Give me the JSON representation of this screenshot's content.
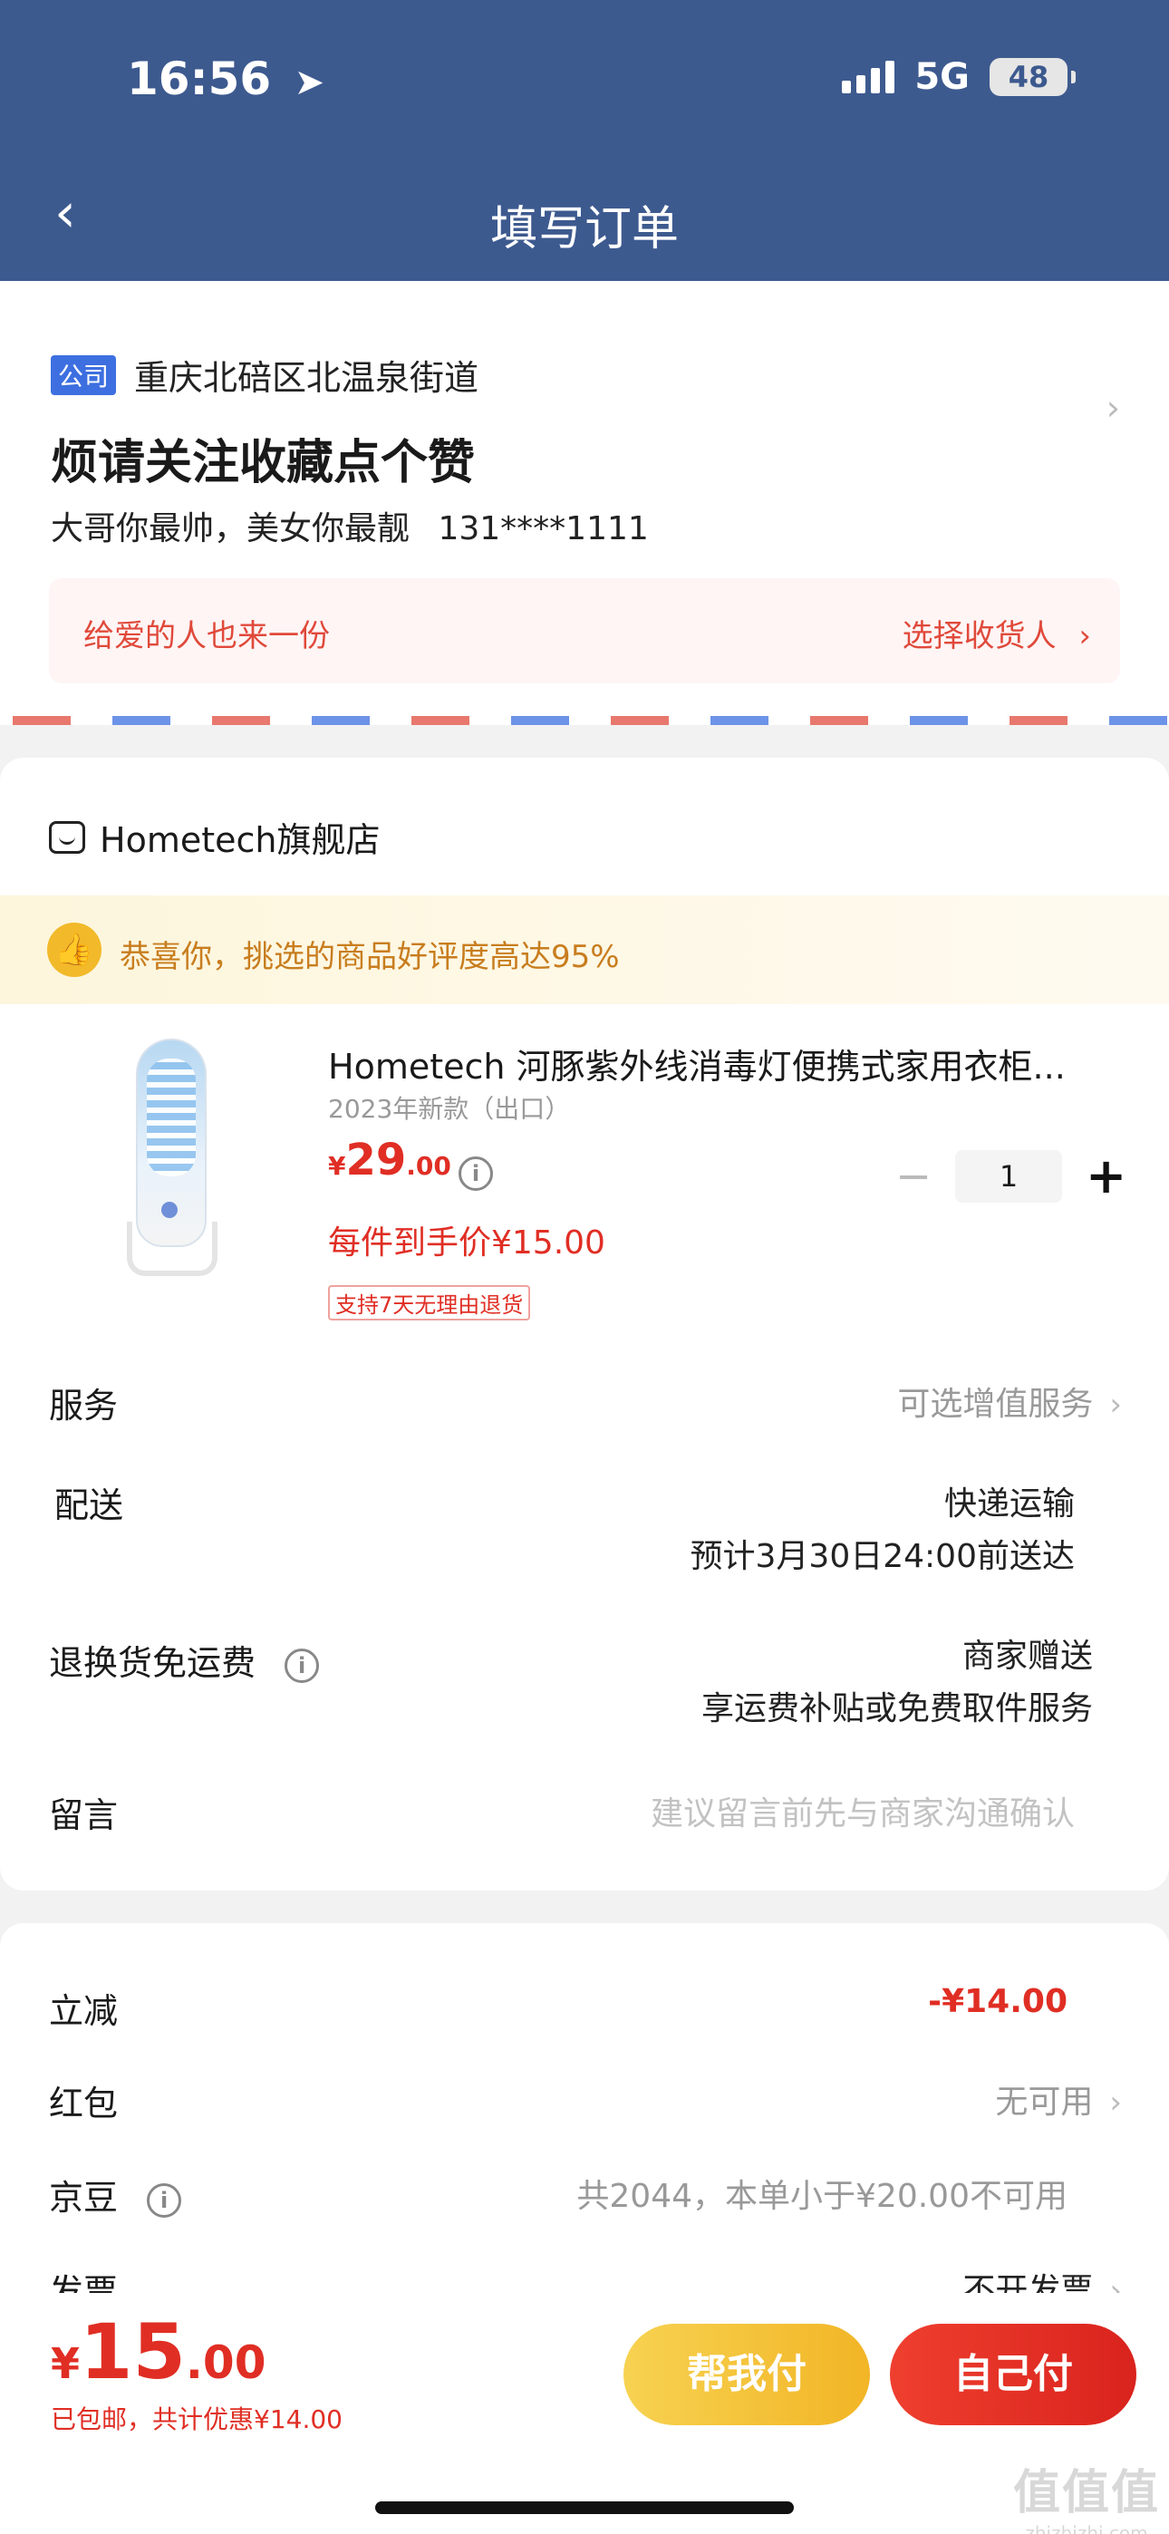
{
  "status_bar": {
    "time": "16:56",
    "network": "5G",
    "battery": "48"
  },
  "header": {
    "back_icon": "chevron-left-icon",
    "title": "填写订单"
  },
  "address": {
    "tag": "公司",
    "region": "重庆北碚区北温泉街道",
    "title": "烦请关注收藏点个赞",
    "name": "大哥你最帅，美女你最靓",
    "phone": "131****1111",
    "gift_left": "给爱的人也来一份",
    "gift_right": "选择收货人"
  },
  "store": {
    "name": "Hometech旗舰店",
    "praise": "恭喜你，挑选的商品好评度高达95%",
    "product": {
      "name": "Hometech 河豚紫外线消毒灯便携式家用衣柜...",
      "variant": "2023年新款（出口）",
      "price_symbol": "¥",
      "price_int": "29",
      "price_dec": ".00",
      "unit_price": "每件到手价¥15.00",
      "return_badge": "支持7天无理由退货",
      "quantity": "1",
      "minus": "−",
      "plus": "+"
    },
    "rows": {
      "service_label": "服务",
      "service_value": "可选增值服务",
      "delivery_label": "配送",
      "delivery_value": "快递运输",
      "delivery_eta": "预计3月30日24:00前送达",
      "return_fee_label": "退换货免运费",
      "return_fee_value": "商家赠送",
      "return_fee_detail": "享运费补贴或免费取件服务",
      "message_label": "留言",
      "message_placeholder": "建议留言前先与商家沟通确认"
    }
  },
  "summary": {
    "discount_label": "立减",
    "discount_value": "-¥14.00",
    "redpacket_label": "红包",
    "redpacket_value": "无可用",
    "jingdou_label": "京豆",
    "jingdou_value": "共2044，本单小于¥20.00不可用",
    "invoice_label": "发票",
    "invoice_value": "不开发票"
  },
  "footer": {
    "total_symbol": "¥",
    "total_int": "15",
    "total_dec": ".00",
    "total_note": "已包邮，共计优惠¥14.00",
    "help_pay": "帮我付",
    "self_pay": "自己付"
  },
  "watermark": {
    "big": "值值值",
    "small": "zhizhizhi.com"
  },
  "colors": {
    "header_bg": "#3d5a8f",
    "accent_red": "#e02e24",
    "help_btn": "#f2b526",
    "tag_blue": "#3d6fe0"
  }
}
